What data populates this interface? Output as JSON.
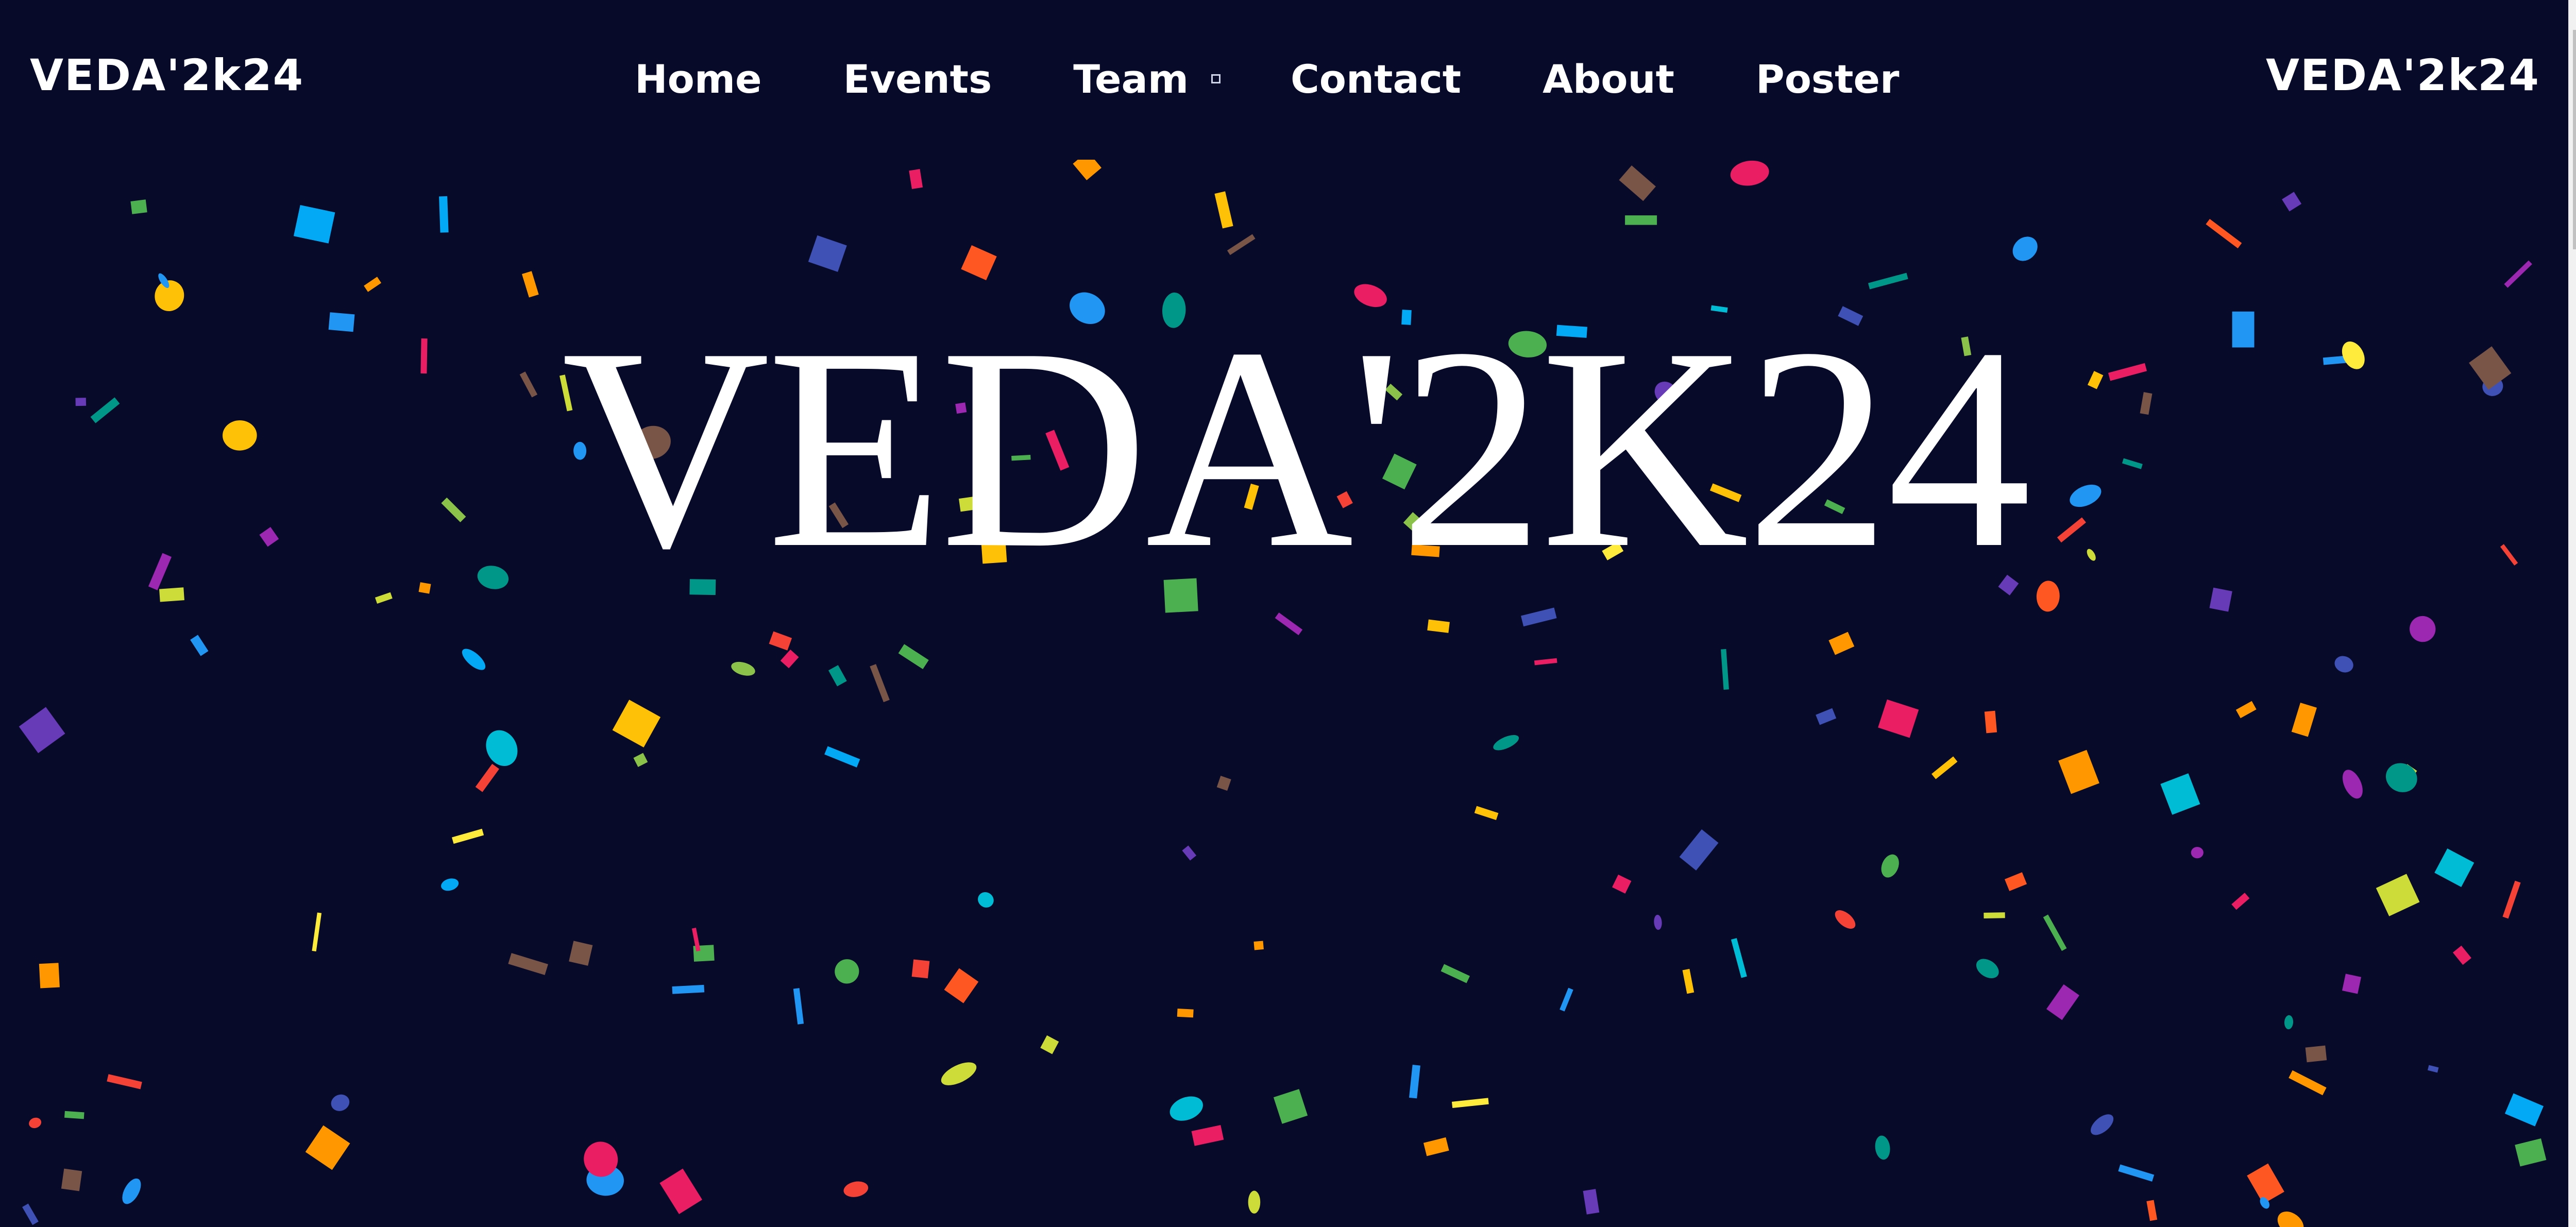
{
  "brand": {
    "left_text": "VEDA'2k24",
    "right_text": "VEDA'2k24"
  },
  "nav": {
    "items": [
      {
        "label": "Home"
      },
      {
        "label": "Events"
      },
      {
        "label": "Team"
      },
      {
        "label": "Contact"
      },
      {
        "label": "About"
      },
      {
        "label": "Poster"
      }
    ]
  },
  "hero": {
    "title": "VEDA'2K24"
  },
  "colors": {
    "background": "#080a2a",
    "text": "#ffffff",
    "confetti": [
      "#e91e63",
      "#ffc107",
      "#03a9f4",
      "#cddc39",
      "#9c27b0",
      "#ff5722",
      "#00bcd4",
      "#673ab7",
      "#4caf50",
      "#2196f3",
      "#ff9800",
      "#795548",
      "#3f51b5",
      "#009688",
      "#ffeb3b",
      "#8bc34a",
      "#f44336"
    ]
  }
}
